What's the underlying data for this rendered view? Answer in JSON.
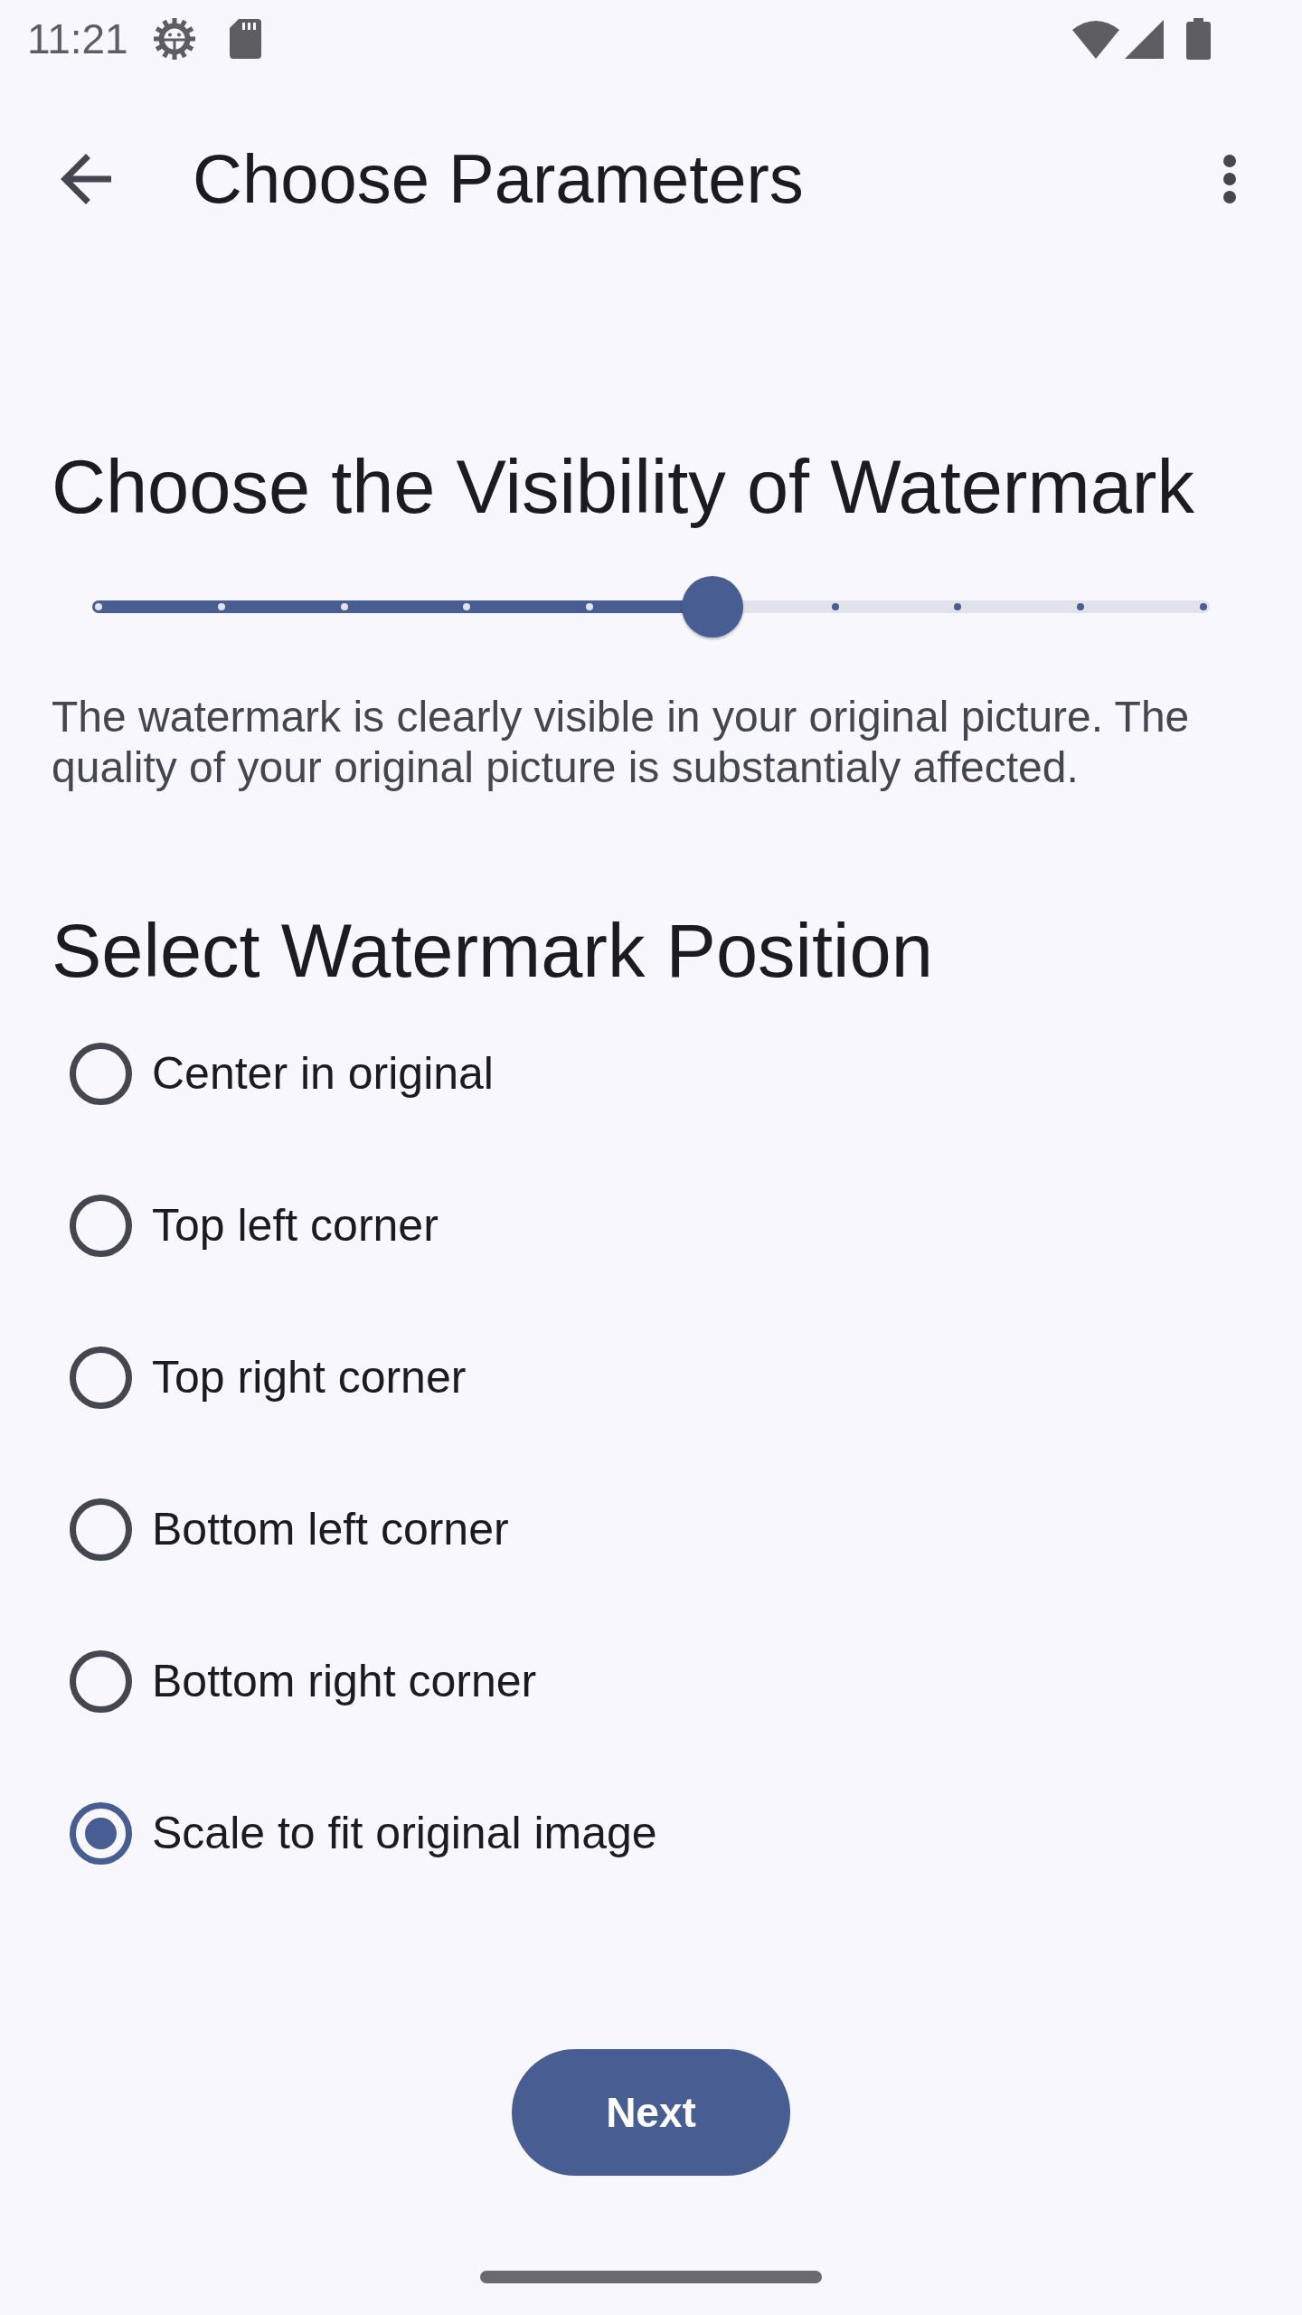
{
  "status_bar": {
    "time": "11:21"
  },
  "app_bar": {
    "title": "Choose Parameters"
  },
  "visibility": {
    "heading": "Choose the Visibility of Watermark",
    "slider": {
      "level": 0.556
    },
    "description": "The watermark is clearly visible in your original picture. The quality of your original picture is substantialy affected."
  },
  "position": {
    "heading": "Select Watermark Position",
    "options": [
      {
        "label": "Center in original",
        "selected": false
      },
      {
        "label": "Top left corner",
        "selected": false
      },
      {
        "label": "Top right corner",
        "selected": false
      },
      {
        "label": "Bottom left corner",
        "selected": false
      },
      {
        "label": "Bottom right corner",
        "selected": false
      },
      {
        "label": "Scale to fit original image",
        "selected": true
      }
    ]
  },
  "next_button": {
    "label": "Next"
  }
}
